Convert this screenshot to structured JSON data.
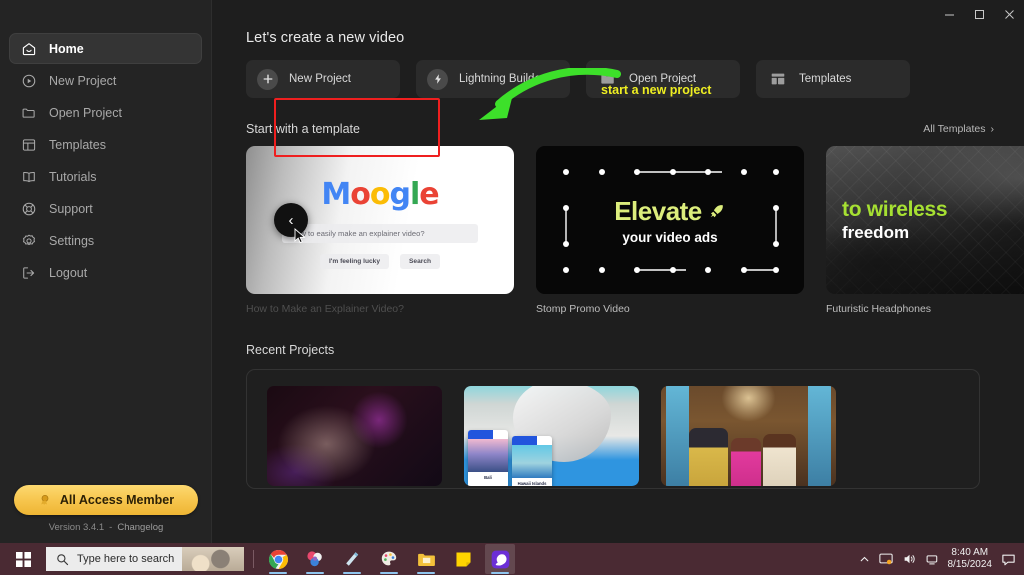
{
  "window": {
    "minimize_label": "–",
    "maximize_label": "□",
    "close_label": "✕"
  },
  "sidebar": {
    "items": [
      {
        "label": "Home",
        "icon": "home-icon",
        "active": true
      },
      {
        "label": "New Project",
        "icon": "play-circle-icon",
        "active": false
      },
      {
        "label": "Open Project",
        "icon": "folder-icon",
        "active": false
      },
      {
        "label": "Templates",
        "icon": "layout-icon",
        "active": false
      },
      {
        "label": "Tutorials",
        "icon": "book-icon",
        "active": false
      },
      {
        "label": "Support",
        "icon": "lifebuoy-icon",
        "active": false
      },
      {
        "label": "Settings",
        "icon": "gear-icon",
        "active": false
      },
      {
        "label": "Logout",
        "icon": "logout-icon",
        "active": false
      }
    ],
    "membership_label": "All Access Member",
    "version_label": "Version 3.4.1",
    "version_separator": "-",
    "changelog_label": "Changelog"
  },
  "main": {
    "heading": "Let's create a new video",
    "actions": [
      {
        "label": "New Project",
        "icon": "plus-circle-icon"
      },
      {
        "label": "Lightning Builder",
        "icon": "lightning-circle-icon"
      },
      {
        "label": "Open Project",
        "icon": "folder-icon"
      },
      {
        "label": "Templates",
        "icon": "layout-icon"
      }
    ],
    "templates_section": {
      "title": "Start with a template",
      "all_link": "All Templates",
      "all_link_chevron": "›",
      "prev_label": "‹",
      "next_label": "›",
      "cards": [
        {
          "caption": "How to Make an Explainer Video?",
          "moogle_logo": [
            "M",
            "o",
            "o",
            "g",
            "l",
            "e"
          ],
          "search_value": "how to easily make an explainer video?",
          "lucky_button": "I'm feeling lucky",
          "search_button": "Search"
        },
        {
          "caption": "Stomp Promo Video",
          "headline": "Elevate",
          "subline": "your video ads"
        },
        {
          "caption": "Futuristic Headphones",
          "headline": "to wireless",
          "subline": "freedom"
        }
      ]
    },
    "recent_section": {
      "title": "Recent Projects",
      "projects": [
        {
          "name": "concert-project-thumbnail"
        },
        {
          "name": "travel-project-thumbnail",
          "card_one": "Bali",
          "card_two": "Hawaii Islands"
        },
        {
          "name": "animated-characters-thumbnail"
        }
      ]
    }
  },
  "annotation": {
    "text": "start a new project",
    "text_color": "#eeee22",
    "arrow_color": "#3de02a",
    "highlight_color": "#ef1f1f"
  },
  "taskbar": {
    "start_label": "start-button",
    "search_placeholder": "Type here to search",
    "apps": [
      {
        "name": "chrome-icon",
        "active": true
      },
      {
        "name": "photos-icon",
        "active": true
      },
      {
        "name": "file-icon",
        "active": true
      },
      {
        "name": "paint-icon",
        "active": true
      },
      {
        "name": "file-explorer-icon",
        "active": true
      },
      {
        "name": "sticky-notes-icon",
        "active": false
      },
      {
        "name": "video-editor-icon",
        "active": true
      }
    ],
    "time": "8:40 AM",
    "date": "8/15/2024"
  }
}
